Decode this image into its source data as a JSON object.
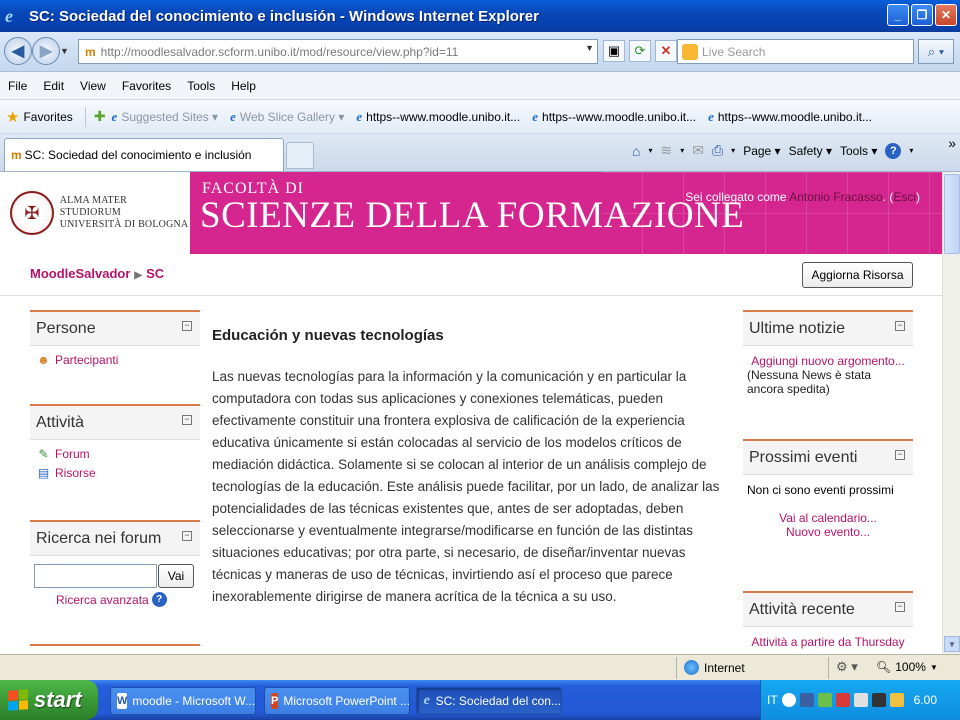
{
  "window": {
    "title": "SC: Sociedad del conocimiento e inclusión - Windows Internet Explorer",
    "buttons": [
      "_",
      "□",
      "✕"
    ]
  },
  "address_bar": {
    "url": "http://moodlesalvador.scform.unibo.it/mod/resource/view.php?id=11",
    "search_placeholder": "Live Search"
  },
  "menu": [
    "File",
    "Edit",
    "View",
    "Favorites",
    "Tools",
    "Help"
  ],
  "favorites_bar": {
    "favorites_label": "Favorites",
    "items": [
      {
        "label": "Suggested Sites ▾",
        "dim": true
      },
      {
        "label": "Web Slice Gallery ▾",
        "dim": true
      },
      {
        "label": "https--www.moodle.unibo.it...",
        "dim": false
      },
      {
        "label": "https--www.moodle.unibo.it...",
        "dim": false
      },
      {
        "label": "https--www.moodle.unibo.it...",
        "dim": false
      }
    ]
  },
  "tab": {
    "label": "SC: Sociedad del conocimiento e inclusión"
  },
  "command_bar": {
    "page": "Page",
    "safety": "Safety",
    "tools": "Tools"
  },
  "header": {
    "univ_line1": "ALMA MATER STUDIORUM",
    "univ_line2": "UNIVERSITÀ DI BOLOGNA",
    "faculty_small": "FACOLTÀ DI",
    "faculty_big": "SCIENZE DELLA FORMAZIONE",
    "login_prefix": "Sei collegato come ",
    "login_user": "Antonio Fracasso",
    "login_mid": ". (",
    "login_exit": "Esci",
    "login_suffix": ")"
  },
  "navbar": {
    "crumb_home": "MoodleSalvador",
    "crumb_course": "SC",
    "update_button": "Aggiorna Risorsa"
  },
  "left_blocks": {
    "people_title": "Persone",
    "participants": "Partecipanti",
    "activities_title": "Attività",
    "forum": "Forum",
    "resources": "Risorse",
    "search_title": "Ricerca nei forum",
    "search_button": "Vai",
    "advanced_search": "Ricerca avanzata"
  },
  "main": {
    "title": "Educación y nuevas tecnologías",
    "body": "Las nuevas tecnologías para la información y la comunicación y en particular la computadora con todas sus aplicaciones y conexiones telemáticas, pueden efectivamente constituir una frontera explosiva de calificación de la experiencia educativa únicamente si están colocadas al servicio de los modelos críticos de mediación didáctica. Solamente si se colocan al interior de un análisis complejo de tecnologías de la educación. Este análisis puede facilitar, por un lado, de analizar las potencialidades de las técnicas existentes que, antes de ser adoptadas, deben seleccionarse y eventualmente integrarse/modificarse en función de las distintas situaciones educativas; por otra parte, si necesario, de diseñar/inventar nuevas técnicas y maneras de uso de técnicas, invirtiendo así el proceso que parece inexorablemente dirigirse de manera acrítica de la técnica a su uso."
  },
  "right_blocks": {
    "news_title": "Ultime notizie",
    "news_add": "Aggiungi nuovo argomento...",
    "news_none": "(Nessuna News è stata ancora spedita)",
    "events_title": "Prossimi eventi",
    "events_none": "Non ci sono eventi prossimi",
    "events_calendar": "Vai al calendario...",
    "events_new": "Nuovo evento...",
    "recent_title": "Attività recente",
    "recent_since": "Attività a partire da Thursday"
  },
  "status_bar": {
    "zone": "Internet",
    "zoom": "100%"
  },
  "taskbar": {
    "start": "start",
    "tasks": [
      {
        "label": "moodle - Microsoft W...",
        "active": false
      },
      {
        "label": "Microsoft PowerPoint ...",
        "active": false
      },
      {
        "label": "SC: Sociedad del con...",
        "active": true
      }
    ],
    "lang": "IT",
    "clock": "6.00"
  },
  "colors": {
    "brand_magenta": "#d4268e",
    "link": "#b5136b",
    "block_accent": "#d97a4a"
  }
}
